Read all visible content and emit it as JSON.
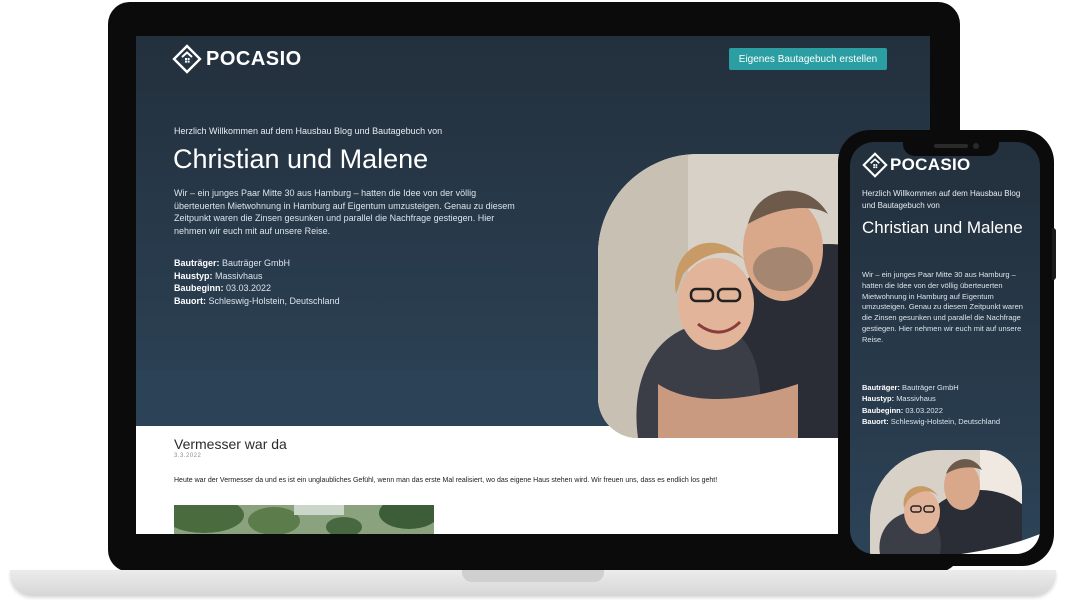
{
  "brand": {
    "name": "POCASIO",
    "logo_icon": "house-diamond-icon"
  },
  "header": {
    "cta_label": "Eigenes Bautagebuch erstellen"
  },
  "hero": {
    "welcome": "Herzlich Willkommen auf dem Hausbau Blog und Bautagebuch von",
    "title": "Christian und Malene",
    "intro": "Wir – ein junges Paar Mitte 30 aus Hamburg – hatten die Idee von der völlig überteuerten Mietwohnung in Hamburg auf Eigentum umzusteigen. Genau zu diesem Zeitpunkt waren die Zinsen gesunken und parallel die Nachfrage gestiegen. Hier nehmen wir euch mit auf unsere Reise.",
    "facts": [
      {
        "label": "Bauträger:",
        "value": "Bauträger GmbH"
      },
      {
        "label": "Haustyp:",
        "value": "Massivhaus"
      },
      {
        "label": "Baubeginn:",
        "value": "03.03.2022"
      },
      {
        "label": "Bauort:",
        "value": "Schleswig-Holstein, Deutschland"
      }
    ]
  },
  "post": {
    "title": "Vermesser war da",
    "date": "3.3.2022",
    "text": "Heute war der Vermesser da und es ist ein unglaubliches Gefühl, wenn man das erste Mal realisiert, wo das eigene Haus stehen wird. Wir freuen uns, dass es endlich los geht!"
  },
  "colors": {
    "hero_bg": "#283a4b",
    "accent": "#2a9ea2",
    "text_light": "#ffffff"
  }
}
